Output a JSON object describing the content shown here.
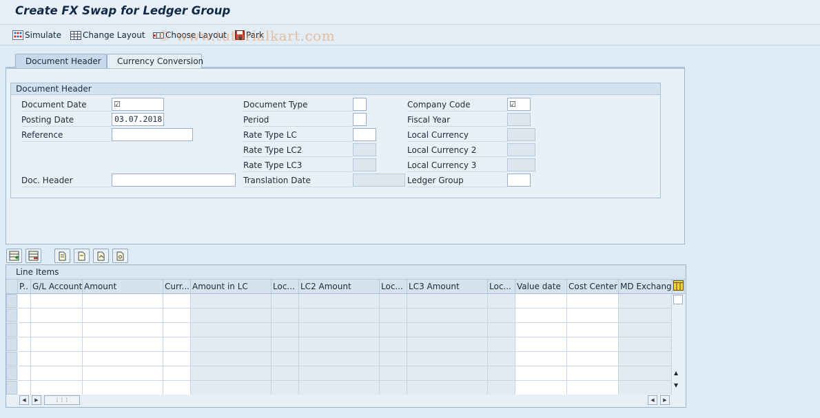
{
  "window": {
    "title": "Create FX Swap for Ledger Group"
  },
  "watermark": "© www.tutorialkart.com",
  "toolbar": {
    "simulate": "Simulate",
    "change_layout": "Change Layout",
    "choose_layout": "Choose Layout",
    "park": "Park"
  },
  "tabs": [
    {
      "label": "Document Header",
      "active": true
    },
    {
      "label": "Currency Conversion",
      "active": false
    }
  ],
  "doc_header": {
    "group_title": "Document Header",
    "document_date": {
      "label": "Document Date",
      "value": ""
    },
    "posting_date": {
      "label": "Posting Date",
      "value": "03.07.2018"
    },
    "reference": {
      "label": "Reference",
      "value": ""
    },
    "doc_header_text": {
      "label": "Doc. Header",
      "value": ""
    },
    "document_type": {
      "label": "Document Type",
      "value": ""
    },
    "period": {
      "label": "Period",
      "value": ""
    },
    "rate_type_lc": {
      "label": "Rate Type LC",
      "value": ""
    },
    "rate_type_lc2": {
      "label": "Rate Type LC2",
      "value": ""
    },
    "rate_type_lc3": {
      "label": "Rate Type LC3",
      "value": ""
    },
    "translation_date": {
      "label": "Translation Date",
      "value": ""
    },
    "company_code": {
      "label": "Company Code",
      "value": ""
    },
    "fiscal_year": {
      "label": "Fiscal Year",
      "value": ""
    },
    "local_currency": {
      "label": "Local Currency",
      "value": ""
    },
    "local_currency_2": {
      "label": "Local Currency 2",
      "value": ""
    },
    "local_currency_3": {
      "label": "Local Currency 3",
      "value": ""
    },
    "ledger_group": {
      "label": "Ledger Group",
      "value": ""
    },
    "required_mark": "☑"
  },
  "line_items": {
    "title": "Line Items",
    "columns": [
      "P..",
      "G/L Account",
      "Amount",
      "Curr...",
      "Amount in LC",
      "Loc...",
      "LC2 Amount",
      "Loc...",
      "LC3 Amount",
      "Loc...",
      "Value date",
      "Cost Center",
      "MD Exchange"
    ],
    "rows": 7
  },
  "colors": {
    "background": "#dfebf5",
    "title_text": "#122a47",
    "readonly_cell": "#e3ebf2"
  }
}
